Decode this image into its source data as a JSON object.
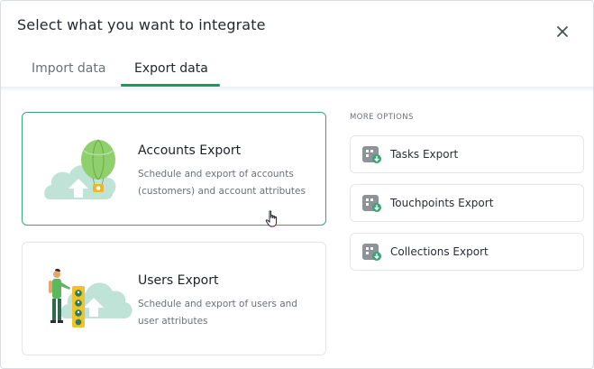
{
  "dialog": {
    "title": "Select what you want to integrate",
    "close_icon": "close-icon"
  },
  "tabs": [
    {
      "label": "Import data",
      "active": false
    },
    {
      "label": "Export data",
      "active": true
    }
  ],
  "export_cards": [
    {
      "title": "Accounts Export",
      "description": "Schedule and export of accounts (customers) and account attributes",
      "selected": true,
      "illustration": "balloon-cloud-illustration"
    },
    {
      "title": "Users Export",
      "description": "Schedule and export of users and user attributes",
      "selected": false,
      "illustration": "person-cloud-illustration"
    }
  ],
  "more_options": {
    "label": "MORE OPTIONS",
    "items": [
      {
        "label": "Tasks Export",
        "icon": "export-grid-icon"
      },
      {
        "label": "Touchpoints Export",
        "icon": "export-grid-icon"
      },
      {
        "label": "Collections Export",
        "icon": "export-grid-icon"
      }
    ]
  },
  "colors": {
    "accent": "#1b9a60",
    "selected_border": "#3aa577",
    "cloud": "#bfe3d6",
    "balloon": "#8fcf6c",
    "icon_gray": "#8e9399"
  }
}
